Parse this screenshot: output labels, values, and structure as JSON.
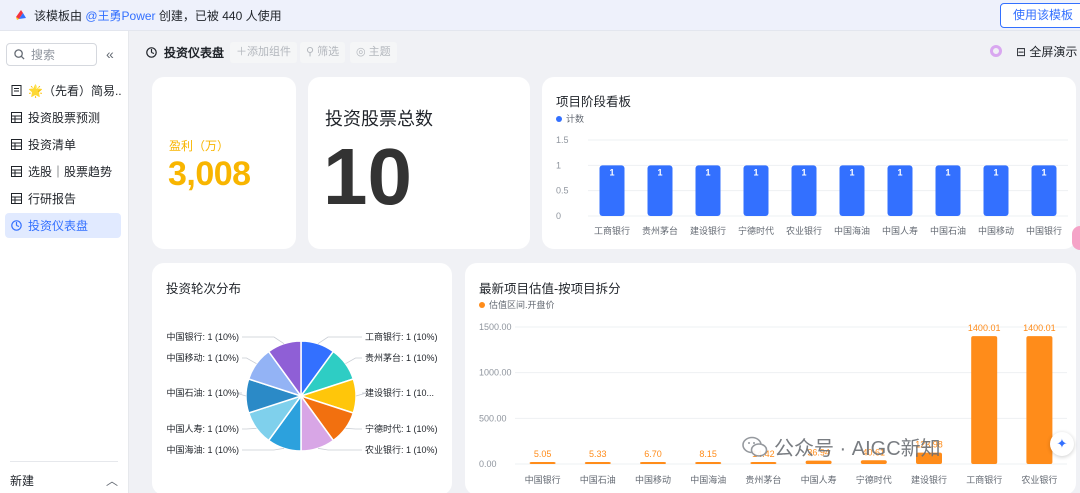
{
  "banner": {
    "prefix": "该模板由",
    "user": "@王勇Power",
    "suffix": "创建，已被 440 人使用",
    "use_button": "使用该模板"
  },
  "sidebar": {
    "search_placeholder": "搜索",
    "items": [
      {
        "label": "🌟（先看）简易..."
      },
      {
        "label": "投资股票预测"
      },
      {
        "label": "投资清单"
      },
      {
        "label": "选股｜股票趋势"
      },
      {
        "label": "行研报告"
      },
      {
        "label": "投资仪表盘"
      }
    ],
    "new_label": "新建"
  },
  "toolbar": {
    "title": "投资仪表盘",
    "add_component": "添加组件",
    "filter": "筛选",
    "theme": "主题",
    "fullscreen": "全屏演示"
  },
  "kpi_profit": {
    "label": "盈利（万）",
    "value": "3,008"
  },
  "kpi_count": {
    "title": "投资股票总数",
    "value": "10"
  },
  "colors": {
    "accent": "#3370ff",
    "bar_blue": "#3370ff",
    "bar_orange": "#ff8c1a",
    "kpi_yellow": "#f8b500"
  },
  "chart_data": [
    {
      "type": "bar",
      "title": "项目阶段看板",
      "legend": [
        "计数"
      ],
      "categories": [
        "工商银行",
        "贵州茅台",
        "建设银行",
        "宁德时代",
        "农业银行",
        "中国海油",
        "中国人寿",
        "中国石油",
        "中国移动",
        "中国银行"
      ],
      "series": [
        {
          "name": "计数",
          "values": [
            1,
            1,
            1,
            1,
            1,
            1,
            1,
            1,
            1,
            1
          ]
        }
      ],
      "y_ticks": [
        "0",
        "0.5",
        "1",
        "1.5"
      ],
      "ylim": [
        0,
        1.5
      ],
      "color": "#3370ff"
    },
    {
      "type": "pie",
      "title": "投资轮次分布",
      "slices": [
        {
          "label": "工商银行: 1 (10%)",
          "value": 1,
          "color": "#3370ff"
        },
        {
          "label": "贵州茅台: 1 (10%)",
          "value": 1,
          "color": "#2ecdc4"
        },
        {
          "label": "建设银行: 1 (10...",
          "value": 1,
          "color": "#ffc60a"
        },
        {
          "label": "宁德时代: 1 (10%)",
          "value": 1,
          "color": "#f2700f"
        },
        {
          "label": "农业银行: 1 (10%)",
          "value": 1,
          "color": "#d8a6e6"
        },
        {
          "label": "中国海油: 1 (10%)",
          "value": 1,
          "color": "#2ca1dd"
        },
        {
          "label": "中国人寿: 1 (10%)",
          "value": 1,
          "color": "#7fd0ec"
        },
        {
          "label": "中国石油: 1 (10%)",
          "value": 1,
          "color": "#2b8ac7"
        },
        {
          "label": "中国移动: 1 (10%)",
          "value": 1,
          "color": "#93b3f5"
        },
        {
          "label": "中国银行: 1 (10%)",
          "value": 1,
          "color": "#8f5fd6"
        }
      ]
    },
    {
      "type": "bar",
      "title": "最新项目估值-按项目拆分",
      "legend": [
        "估值区间.开盘价"
      ],
      "categories": [
        "中国银行",
        "中国石油",
        "中国移动",
        "中国海油",
        "贵州茅台",
        "中国人寿",
        "宁德时代",
        "建设银行",
        "工商银行",
        "农业银行"
      ],
      "series": [
        {
          "name": "估值区间.开盘价",
          "values": [
            5.05,
            5.33,
            6.7,
            8.15,
            14.42,
            36.94,
            40.61,
            123.98,
            1400.01,
            1400.01
          ]
        }
      ],
      "value_labels": [
        "5.05",
        "5.33",
        "6.70",
        "8.15",
        "14.42",
        "36.94",
        "40.61",
        "123.98",
        "1400.01",
        "1400.01"
      ],
      "y_ticks": [
        "0.00",
        "500.00",
        "1000.00",
        "1500.00"
      ],
      "ylim": [
        0,
        1500
      ],
      "color": "#ff8c1a"
    }
  ],
  "watermark": {
    "text": "公众号 · AIGC新知"
  }
}
